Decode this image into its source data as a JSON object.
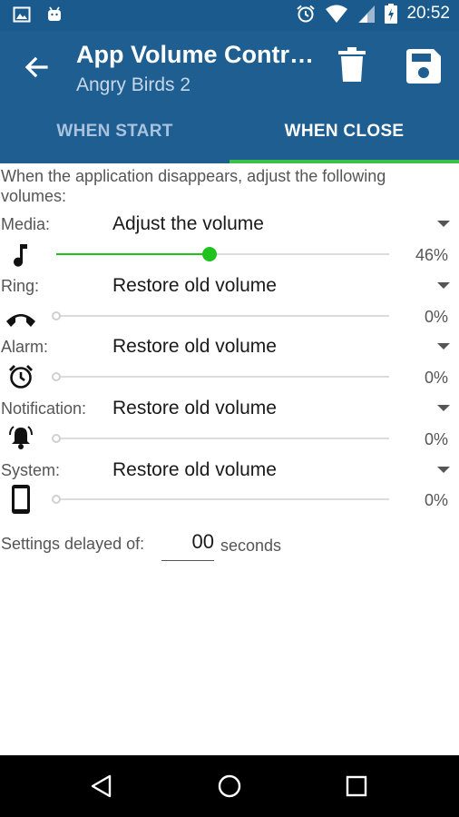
{
  "status_bar": {
    "time": "20:52"
  },
  "app_bar": {
    "title": "App Volume Contr…",
    "subtitle": "Angry Birds 2"
  },
  "tabs": [
    {
      "label": "WHEN START",
      "selected": false
    },
    {
      "label": "WHEN CLOSE",
      "selected": true
    }
  ],
  "description": "When the application disappears, adjust the following volumes:",
  "volumes": [
    {
      "label": "Media:",
      "mode": "Adjust the volume",
      "icon": "music-note-icon",
      "level": 0.46,
      "percent": "46%",
      "active": true
    },
    {
      "label": "Ring:",
      "mode": "Restore old volume",
      "icon": "phone-hangup-icon",
      "level": 0,
      "percent": "0%",
      "active": false
    },
    {
      "label": "Alarm:",
      "mode": "Restore old volume",
      "icon": "alarm-clock-icon",
      "level": 0,
      "percent": "0%",
      "active": false
    },
    {
      "label": "Notification:",
      "mode": "Restore old volume",
      "icon": "bell-icon",
      "level": 0,
      "percent": "0%",
      "active": false
    },
    {
      "label": "System:",
      "mode": "Restore old volume",
      "icon": "smartphone-icon",
      "level": 0,
      "percent": "0%",
      "active": false
    }
  ],
  "delay": {
    "label": "Settings delayed of:",
    "value": "00",
    "unit": "seconds"
  },
  "colors": {
    "primary": "#1f5e91",
    "status_bar": "#1b5a8c",
    "accent": "#3ac14a",
    "slider_active": "#1fc21f"
  }
}
